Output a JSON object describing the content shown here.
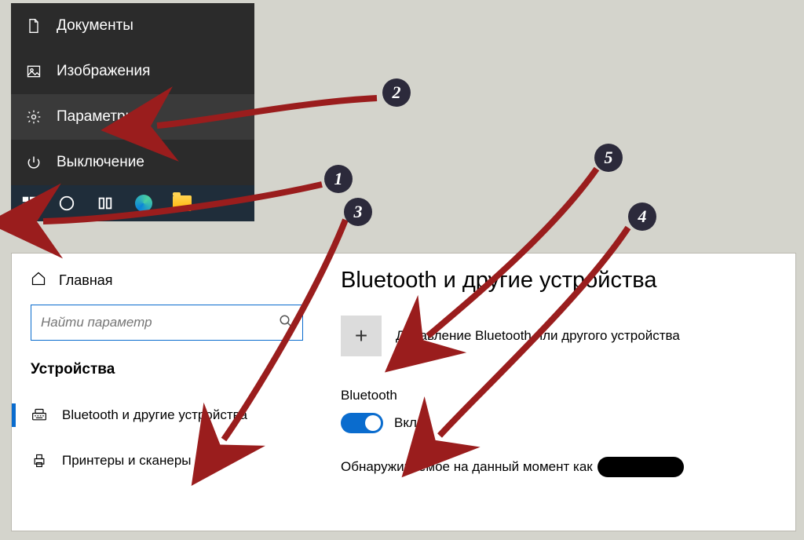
{
  "start_menu": {
    "items": [
      {
        "label": "Документы",
        "icon": "document"
      },
      {
        "label": "Изображения",
        "icon": "image"
      },
      {
        "label": "Параметры",
        "icon": "gear",
        "hover": true
      },
      {
        "label": "Выключение",
        "icon": "power"
      }
    ]
  },
  "settings_left": {
    "home_label": "Главная",
    "search_placeholder": "Найти параметр",
    "section_title": "Устройства",
    "nav": [
      {
        "label": "Bluetooth и другие устройства",
        "icon": "keyboard",
        "active": true
      },
      {
        "label": "Принтеры и сканеры",
        "icon": "printer",
        "active": false
      }
    ]
  },
  "settings_right": {
    "page_title": "Bluetooth и другие устройства",
    "add_label": "Добавление Bluetooth или другого устройства",
    "bluetooth_label": "Bluetooth",
    "toggle_state_label": "Вкл.",
    "discoverable_text": "Обнаруживаемое на данный момент как"
  },
  "annotations": {
    "badges": [
      "1",
      "2",
      "3",
      "4",
      "5"
    ]
  },
  "colors": {
    "accent": "#0a6cce",
    "arrow": "#9a1d1d",
    "badge": "#2c2a3b"
  }
}
